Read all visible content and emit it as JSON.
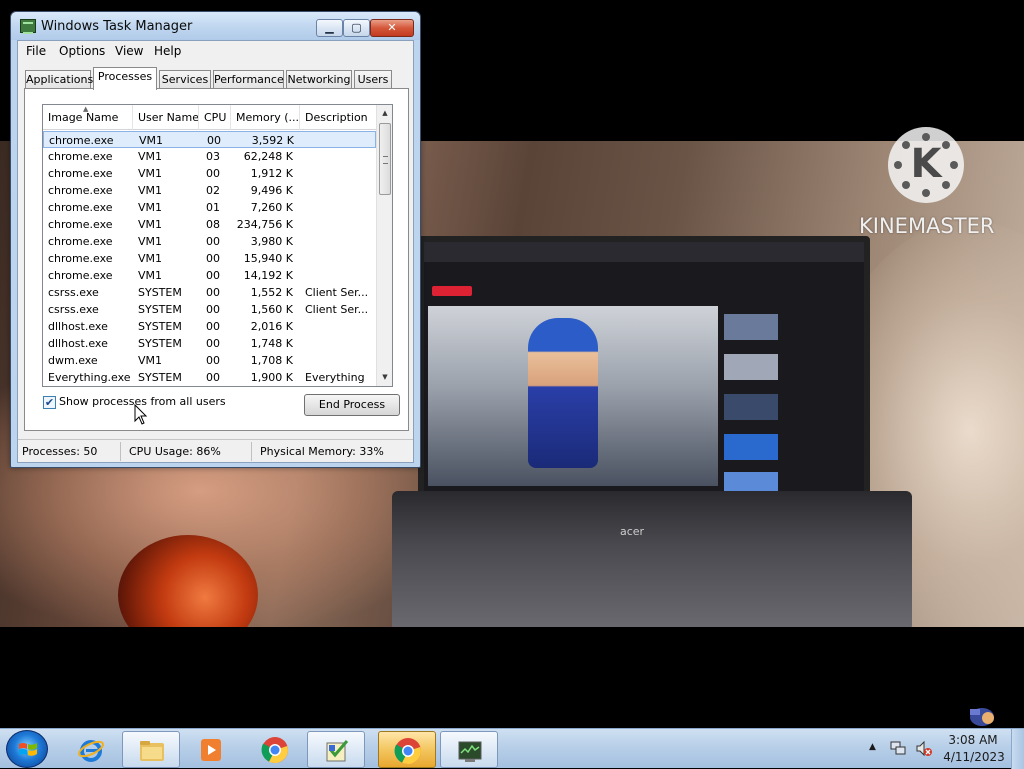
{
  "window": {
    "title": "Windows Task Manager",
    "minimize_label": "▁",
    "maximize_label": "▢",
    "close_label": "✕"
  },
  "menu": [
    "File",
    "Options",
    "View",
    "Help"
  ],
  "tabs": [
    "Applications",
    "Processes",
    "Services",
    "Performance",
    "Networking",
    "Users"
  ],
  "active_tab": "Processes",
  "columns": [
    "Image Name",
    "User Name",
    "CPU",
    "Memory (...",
    "Description"
  ],
  "processes": [
    {
      "name": "chrome.exe",
      "user": "VM1",
      "cpu": "00",
      "memory": "3,592 K",
      "description": ""
    },
    {
      "name": "chrome.exe",
      "user": "VM1",
      "cpu": "03",
      "memory": "62,248 K",
      "description": ""
    },
    {
      "name": "chrome.exe",
      "user": "VM1",
      "cpu": "00",
      "memory": "1,912 K",
      "description": ""
    },
    {
      "name": "chrome.exe",
      "user": "VM1",
      "cpu": "02",
      "memory": "9,496 K",
      "description": ""
    },
    {
      "name": "chrome.exe",
      "user": "VM1",
      "cpu": "01",
      "memory": "7,260 K",
      "description": ""
    },
    {
      "name": "chrome.exe",
      "user": "VM1",
      "cpu": "08",
      "memory": "234,756 K",
      "description": ""
    },
    {
      "name": "chrome.exe",
      "user": "VM1",
      "cpu": "00",
      "memory": "3,980 K",
      "description": ""
    },
    {
      "name": "chrome.exe",
      "user": "VM1",
      "cpu": "00",
      "memory": "15,940 K",
      "description": ""
    },
    {
      "name": "chrome.exe",
      "user": "VM1",
      "cpu": "00",
      "memory": "14,192 K",
      "description": ""
    },
    {
      "name": "csrss.exe",
      "user": "SYSTEM",
      "cpu": "00",
      "memory": "1,552 K",
      "description": "Client Ser..."
    },
    {
      "name": "csrss.exe",
      "user": "SYSTEM",
      "cpu": "00",
      "memory": "1,560 K",
      "description": "Client Ser..."
    },
    {
      "name": "dllhost.exe",
      "user": "SYSTEM",
      "cpu": "00",
      "memory": "2,016 K",
      "description": ""
    },
    {
      "name": "dllhost.exe",
      "user": "SYSTEM",
      "cpu": "00",
      "memory": "1,748 K",
      "description": ""
    },
    {
      "name": "dwm.exe",
      "user": "VM1",
      "cpu": "00",
      "memory": "1,708 K",
      "description": ""
    },
    {
      "name": "Everything.exe",
      "user": "SYSTEM",
      "cpu": "00",
      "memory": "1,900 K",
      "description": "Everything"
    }
  ],
  "selected_row": 0,
  "show_all_processes": {
    "label": "Show processes from all users",
    "checked": true,
    "check_glyph": "✔"
  },
  "end_process_label": "End Process",
  "status": {
    "processes": "Processes: 50",
    "cpu": "CPU Usage: 86%",
    "memory": "Physical Memory: 33%"
  },
  "scroll": {
    "up_glyph": "▲",
    "down_glyph": "▼"
  },
  "watermark": {
    "text": "KINEMASTER",
    "logo_letter": "K"
  },
  "video": {
    "laptop_brand": "acer"
  },
  "taskbar": {
    "start_icon": "windows-start-orb",
    "pinned": [
      {
        "name": "internet-explorer-icon",
        "active": false
      },
      {
        "name": "file-explorer-icon",
        "active": true
      },
      {
        "name": "media-player-icon",
        "active": false
      },
      {
        "name": "chrome-icon",
        "active": false
      },
      {
        "name": "setup-wizard-icon",
        "active": true
      },
      {
        "name": "chrome-icon",
        "active": true
      },
      {
        "name": "task-manager-icon",
        "active": true
      }
    ],
    "tray_arrow": "▲",
    "time": "3:08 AM",
    "date": "4/11/2023"
  },
  "colors": {
    "titlebar": "#c1d7f0",
    "selection": "#dfecfb",
    "taskbar": "#b8cfe8",
    "close_button": "#c23a20"
  }
}
